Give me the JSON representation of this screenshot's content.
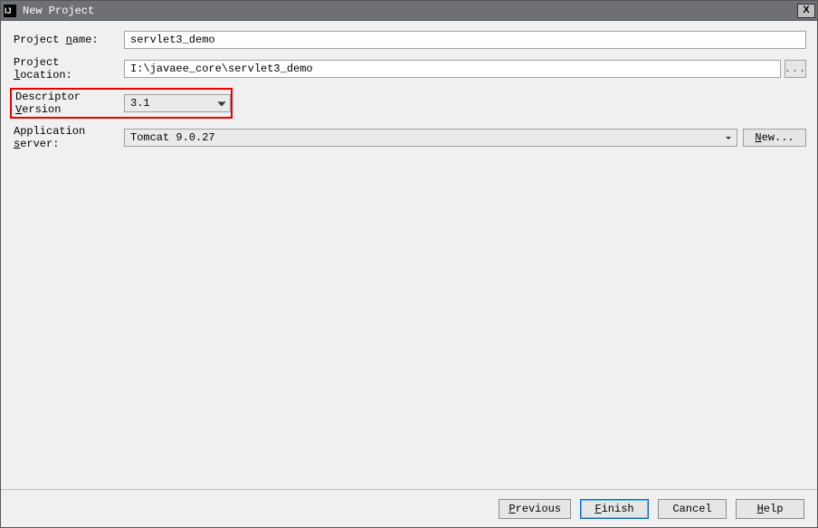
{
  "window": {
    "title": "New Project",
    "close_label": "X"
  },
  "form": {
    "project_name": {
      "label_prefix": "Project ",
      "label_u": "n",
      "label_suffix": "ame:",
      "value": "servlet3_demo"
    },
    "project_location": {
      "label_prefix": "Project ",
      "label_u": "l",
      "label_suffix": "ocation:",
      "value": "I:\\javaee_core\\servlet3_demo",
      "browse": "..."
    },
    "descriptor_version": {
      "label_prefix": "Descriptor ",
      "label_u": "V",
      "label_suffix": "ersion",
      "value": "3.1"
    },
    "application_server": {
      "label_prefix": "Application ",
      "label_u": "s",
      "label_suffix": "erver:",
      "value": "Tomcat 9.0.27",
      "new_u": "N",
      "new_suffix": "ew..."
    }
  },
  "footer": {
    "previous": {
      "u": "P",
      "suffix": "revious"
    },
    "finish": {
      "u": "F",
      "suffix": "inish"
    },
    "cancel": {
      "text": "Cancel"
    },
    "help": {
      "u": "H",
      "suffix": "elp"
    }
  }
}
